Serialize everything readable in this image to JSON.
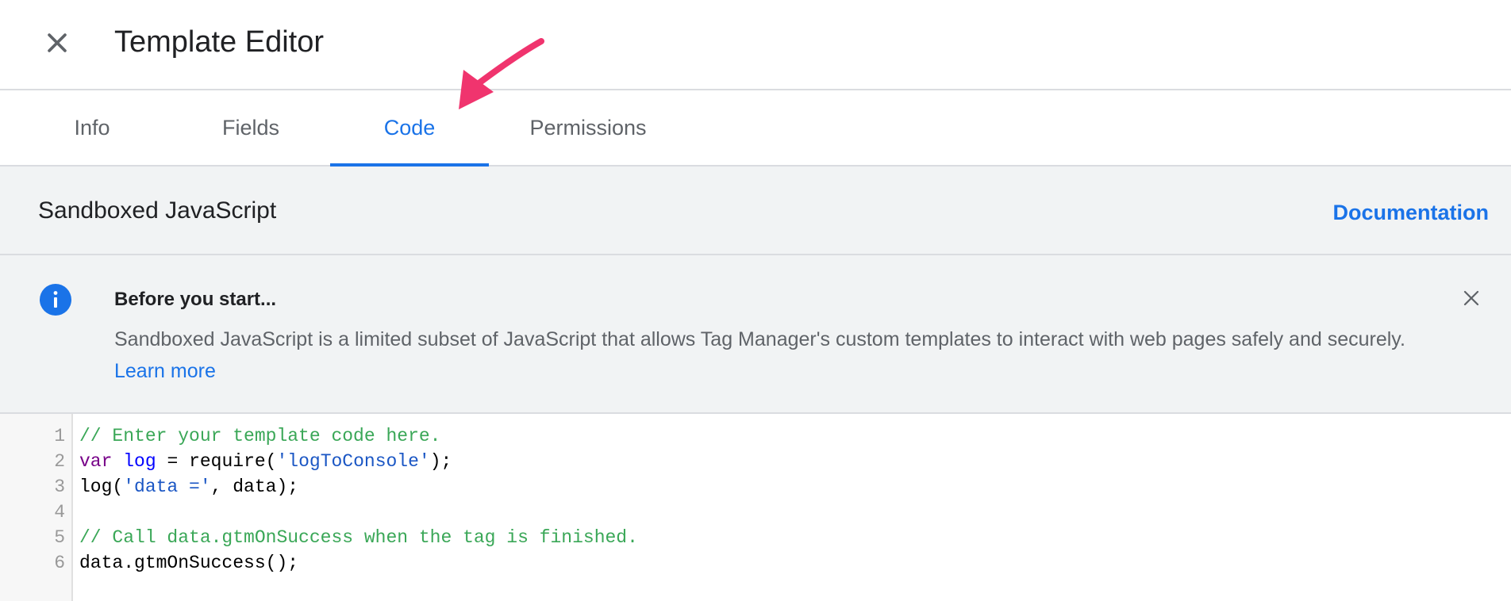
{
  "header": {
    "title": "Template Editor"
  },
  "tabs": [
    {
      "label": "Info",
      "active": false
    },
    {
      "label": "Fields",
      "active": false
    },
    {
      "label": "Code",
      "active": true
    },
    {
      "label": "Permissions",
      "active": false
    }
  ],
  "section": {
    "title": "Sandboxed JavaScript",
    "documentation_link": "Documentation"
  },
  "notice": {
    "title": "Before you start...",
    "body": "Sandboxed JavaScript is a limited subset of JavaScript that allows Tag Manager's custom templates to interact with web pages safely and securely.",
    "learn_more": "Learn more"
  },
  "editor": {
    "line_numbers": [
      "1",
      "2",
      "3",
      "4",
      "5",
      "6"
    ],
    "line1": {
      "comment": "// Enter your template code here."
    },
    "line2": {
      "kw": "var",
      "name": "log",
      "op": " = require(",
      "str": "'logToConsole'",
      "end": ");"
    },
    "line3": {
      "pre": "log(",
      "str": "'data ='",
      "end": ", data);"
    },
    "line5": {
      "comment": "// Call data.gtmOnSuccess when the tag is finished."
    },
    "line6": {
      "text": "data.gtmOnSuccess();"
    }
  },
  "colors": {
    "accent": "#1a73e8",
    "annotation_arrow": "#f0346e",
    "comment": "#3aa757",
    "keyword": "#770088"
  },
  "icons": {
    "close": "close-icon",
    "info": "info-icon",
    "notice_close": "close-icon",
    "annotation": "arrow-annotation"
  }
}
